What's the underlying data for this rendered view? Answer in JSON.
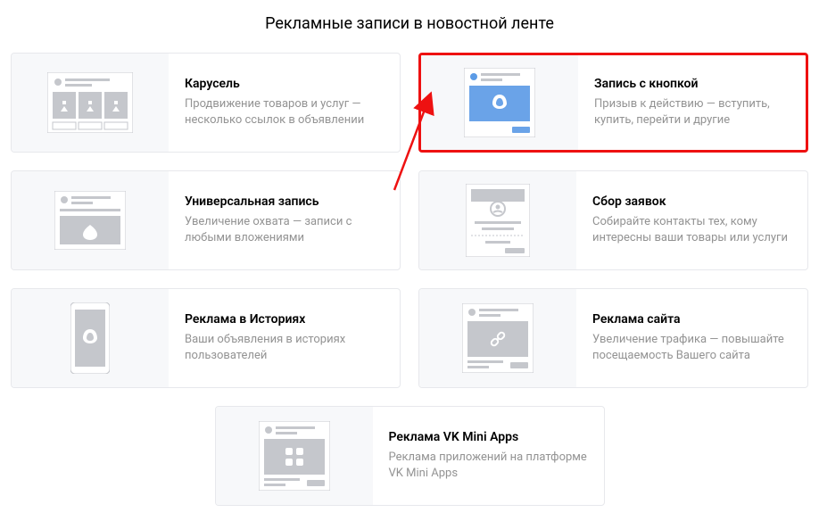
{
  "title": "Рекламные записи в новостной ленте",
  "cards": [
    {
      "title": "Карусель",
      "desc": "Продвижение товаров и услуг — несколько ссылок в объявлении"
    },
    {
      "title": "Запись с кнопкой",
      "desc": "Призыв к действию — вступить, купить, перейти и другие"
    },
    {
      "title": "Универсальная запись",
      "desc": "Увеличение охвата — записи с любыми вложениями"
    },
    {
      "title": "Сбор заявок",
      "desc": "Собирайте контакты тех, кому интересны ваши товары или услуги"
    },
    {
      "title": "Реклама в Историях",
      "desc": "Ваши объявления в историях пользователей"
    },
    {
      "title": "Реклама сайта",
      "desc": "Увеличение трафика — повышайте посещаемость Вашего сайта"
    },
    {
      "title": "Реклама VK Mini Apps",
      "desc": "Реклама приложений на платформе VK Mini Apps"
    }
  ]
}
